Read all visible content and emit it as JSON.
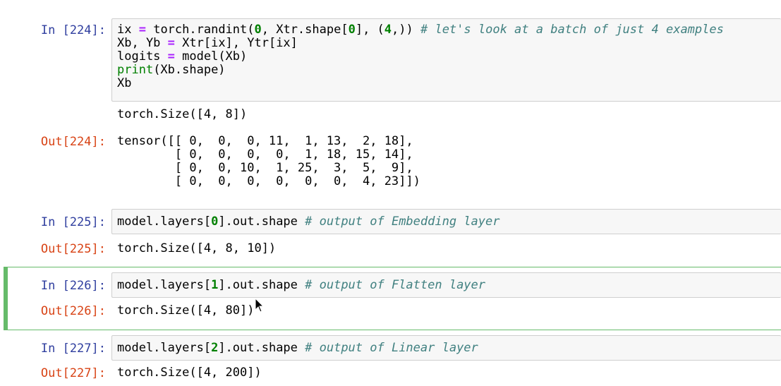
{
  "cells": [
    {
      "in_prompt": "In [224]:",
      "code": [
        [
          "ix ",
          {
            "op": "="
          },
          " torch.randint(",
          {
            "num": "0"
          },
          ", Xtr.shape[",
          {
            "num": "0"
          },
          "], (",
          {
            "num": "4"
          },
          ",)) ",
          {
            "cm": "# let's look at a batch of just 4 examples"
          }
        ],
        [
          "Xb, Yb ",
          {
            "op": "="
          },
          " Xtr[ix], Ytr[ix]"
        ],
        [
          "logits ",
          {
            "op": "="
          },
          " model(Xb)"
        ],
        [
          {
            "kw": "print"
          },
          "(Xb.shape)"
        ],
        [
          "Xb"
        ]
      ],
      "stdout": "torch.Size([4, 8])",
      "out_prompt": "Out[224]:",
      "out_lines": [
        "tensor([[ 0,  0,  0, 11,  1, 13,  2, 18],",
        "        [ 0,  0,  0,  0,  1, 18, 15, 14],",
        "        [ 0,  0, 10,  1, 25,  3,  5,  9],",
        "        [ 0,  0,  0,  0,  0,  0,  4, 23]])"
      ]
    },
    {
      "in_prompt": "In [225]:",
      "code": [
        [
          "model.layers[",
          {
            "num": "0"
          },
          "].out.shape ",
          {
            "cm": "# output of Embedding layer"
          }
        ]
      ],
      "out_prompt": "Out[225]:",
      "out_lines": [
        "torch.Size([4, 8, 10])"
      ]
    },
    {
      "in_prompt": "In [226]:",
      "code": [
        [
          "model.layers[",
          {
            "num": "1"
          },
          "].out.shape ",
          {
            "cm": "# output of Flatten layer"
          }
        ]
      ],
      "out_prompt": "Out[226]:",
      "out_lines": [
        "torch.Size([4, 80])"
      ]
    },
    {
      "in_prompt": "In [227]:",
      "code": [
        [
          "model.layers[",
          {
            "num": "2"
          },
          "].out.shape ",
          {
            "cm": "# output of Linear layer"
          }
        ]
      ],
      "out_prompt": "Out[227]:",
      "out_lines": [
        "torch.Size([4, 200])"
      ]
    }
  ],
  "colors": {
    "in_prompt": "#303f9f",
    "out_prompt": "#d84315",
    "selected_cell_bar": "#66bb6a"
  },
  "icons": {
    "mouse_cursor": "arrow-cursor-icon"
  }
}
